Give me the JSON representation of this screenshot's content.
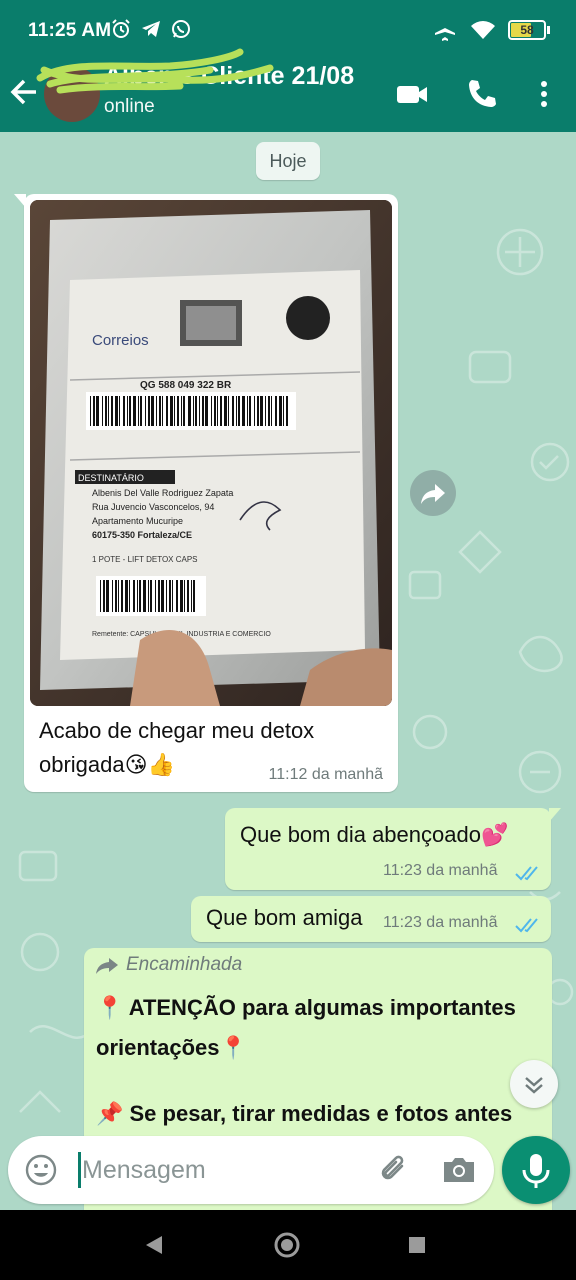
{
  "status_bar": {
    "time": "11:25 AM",
    "battery": "58"
  },
  "header": {
    "contact_name": "Albenis Cliente 21/08",
    "contact_status": "online"
  },
  "chat": {
    "date_chip": "Hoje",
    "incoming": {
      "text": "Acabo de chegar meu detox obrigada😘👍",
      "time": "11:12 da manhã",
      "photo_labels": {
        "brand": "Correios",
        "tracking": "QG 588 049 322 BR",
        "section": "DESTINATÁRIO",
        "recipient": "Albenis Del Valle Rodriguez Zapata",
        "address": "Rua Juvencio Vasconcelos, 94",
        "complement": "Apartamento Mucuripe",
        "city": "60175-350 Fortaleza/CE",
        "product": "1 POTE - LIFT DETOX CAPS",
        "sender": "Remetente: CAPSUL BRASIL INDUSTRIA E COMERCIO"
      }
    },
    "outgoing": [
      {
        "text": "Que bom dia abençoado💕",
        "time": "11:23 da manhã"
      },
      {
        "text": "Que bom amiga",
        "time": "11:23 da manhã"
      }
    ],
    "forwarded": {
      "label": "Encaminhada",
      "line1": "📍 ATENÇÃO para algumas importantes orientações📍",
      "line2": "📌 Se pesar, tirar medidas e fotos antes"
    }
  },
  "composer": {
    "placeholder": "Mensagem"
  },
  "colors": {
    "header": "#0a7d6b",
    "chat_bg": "#aed8c7",
    "outgoing_bubble": "#dcf8c6",
    "mic_button": "#0a8f72"
  },
  "icons": [
    "back-arrow-icon",
    "video-call-icon",
    "phone-icon",
    "more-vert-icon",
    "forward-icon",
    "chevron-down-icon",
    "emoji-icon",
    "attach-icon",
    "camera-icon",
    "mic-icon"
  ]
}
